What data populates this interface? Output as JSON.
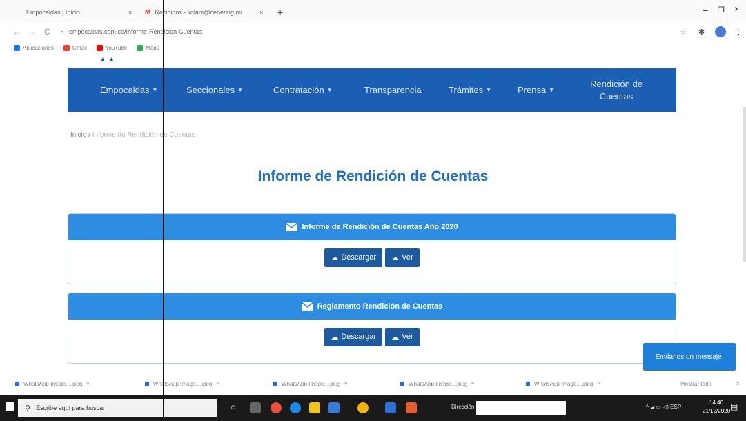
{
  "browser": {
    "tabs": [
      {
        "label": "Empocaldas | Inicio"
      },
      {
        "label": "Recibidos - lidiam@cebering.mi"
      }
    ],
    "new_tab": "+",
    "url": "empocaldas.com.co/Informe-Rendicion-Cuentas",
    "bookmarks": [
      {
        "label": "Aplicaciones",
        "color": "#1a73e8"
      },
      {
        "label": "Gmail",
        "color": "#ea4335"
      },
      {
        "label": "YouTube",
        "color": "#ff0000"
      },
      {
        "label": "Maps",
        "color": "#34a853"
      }
    ]
  },
  "nav": {
    "items": [
      {
        "label": "Empocaldas",
        "caret": true
      },
      {
        "label": "Seccionales",
        "caret": true
      },
      {
        "label": "Contratación",
        "caret": true
      },
      {
        "label": "Transparencia",
        "caret": false
      },
      {
        "label": "Trámites",
        "caret": true
      },
      {
        "label": "Prensa",
        "caret": true
      },
      {
        "label": "Rendición de Cuentas",
        "caret": false
      }
    ]
  },
  "breadcrumb": {
    "home": "Inicio",
    "sep": "/",
    "current": "Informe de Rendición de Cuentas"
  },
  "page_title": "Informe de Rendición de Cuentas",
  "panels": [
    {
      "title": "Informe de Rendición de Cuentas Año 2020",
      "download": "Descargar",
      "view": "Ver"
    },
    {
      "title": "Reglamento Rendición de Cuentas",
      "download": "Descargar",
      "view": "Ver"
    }
  ],
  "chat": "Envíanos un mensaje.",
  "downloads": {
    "items": [
      "WhatsApp Image....jpeg",
      "WhatsApp Image....jpeg",
      "WhatsApp Image....jpeg",
      "WhatsApp Image....jpeg",
      "WhatsApp Image....jpeg"
    ],
    "show_all": "Mostrar todo"
  },
  "taskbar": {
    "search_placeholder": "Escribe aquí para buscar",
    "direccion": "Dirección",
    "lang": "ESP",
    "time": "14:40",
    "date": "21/12/2020"
  },
  "colors": {
    "nav": "#1a5fb4",
    "panel_header": "#2d8de0",
    "button": "#1d5b9e",
    "title": "#1d6fc8"
  }
}
